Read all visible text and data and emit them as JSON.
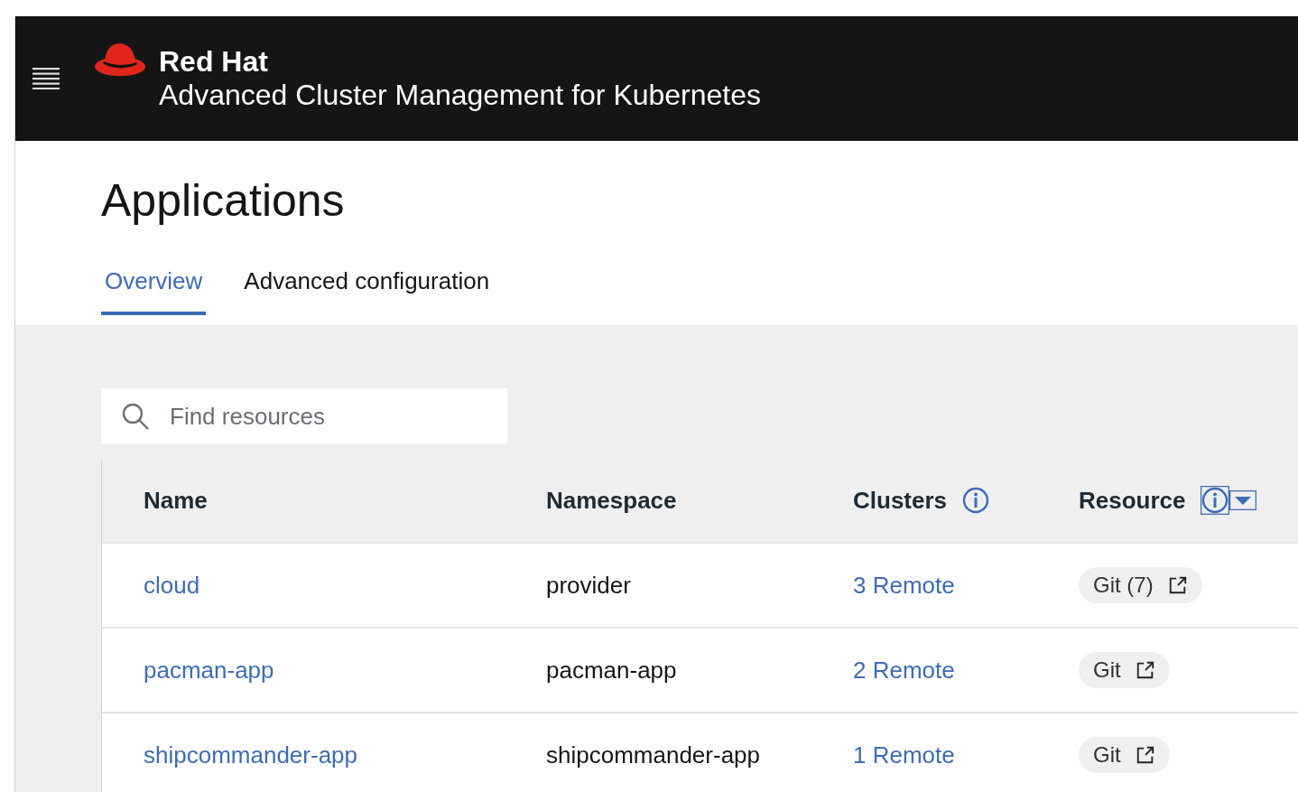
{
  "masthead": {
    "brand": "Red Hat",
    "product": "Advanced Cluster Management for Kubernetes"
  },
  "page_title": "Applications",
  "tabs": [
    {
      "label": "Overview",
      "selected": true
    },
    {
      "label": "Advanced configuration",
      "selected": false
    }
  ],
  "search": {
    "placeholder": "Find resources"
  },
  "table": {
    "columns": [
      {
        "label": "Name",
        "info": false,
        "sort_menu": false
      },
      {
        "label": "Namespace",
        "info": false,
        "sort_menu": false
      },
      {
        "label": "Clusters",
        "info": true,
        "sort_menu": false
      },
      {
        "label": "Resource",
        "info": true,
        "sort_menu": true
      }
    ],
    "rows": [
      {
        "name": "cloud",
        "namespace": "provider",
        "clusters": "3 Remote",
        "resource": "Git (7)"
      },
      {
        "name": "pacman-app",
        "namespace": "pacman-app",
        "clusters": "2 Remote",
        "resource": "Git"
      },
      {
        "name": "shipcommander-app",
        "namespace": "shipcommander-app",
        "clusters": "1 Remote",
        "resource": "Git"
      }
    ]
  }
}
